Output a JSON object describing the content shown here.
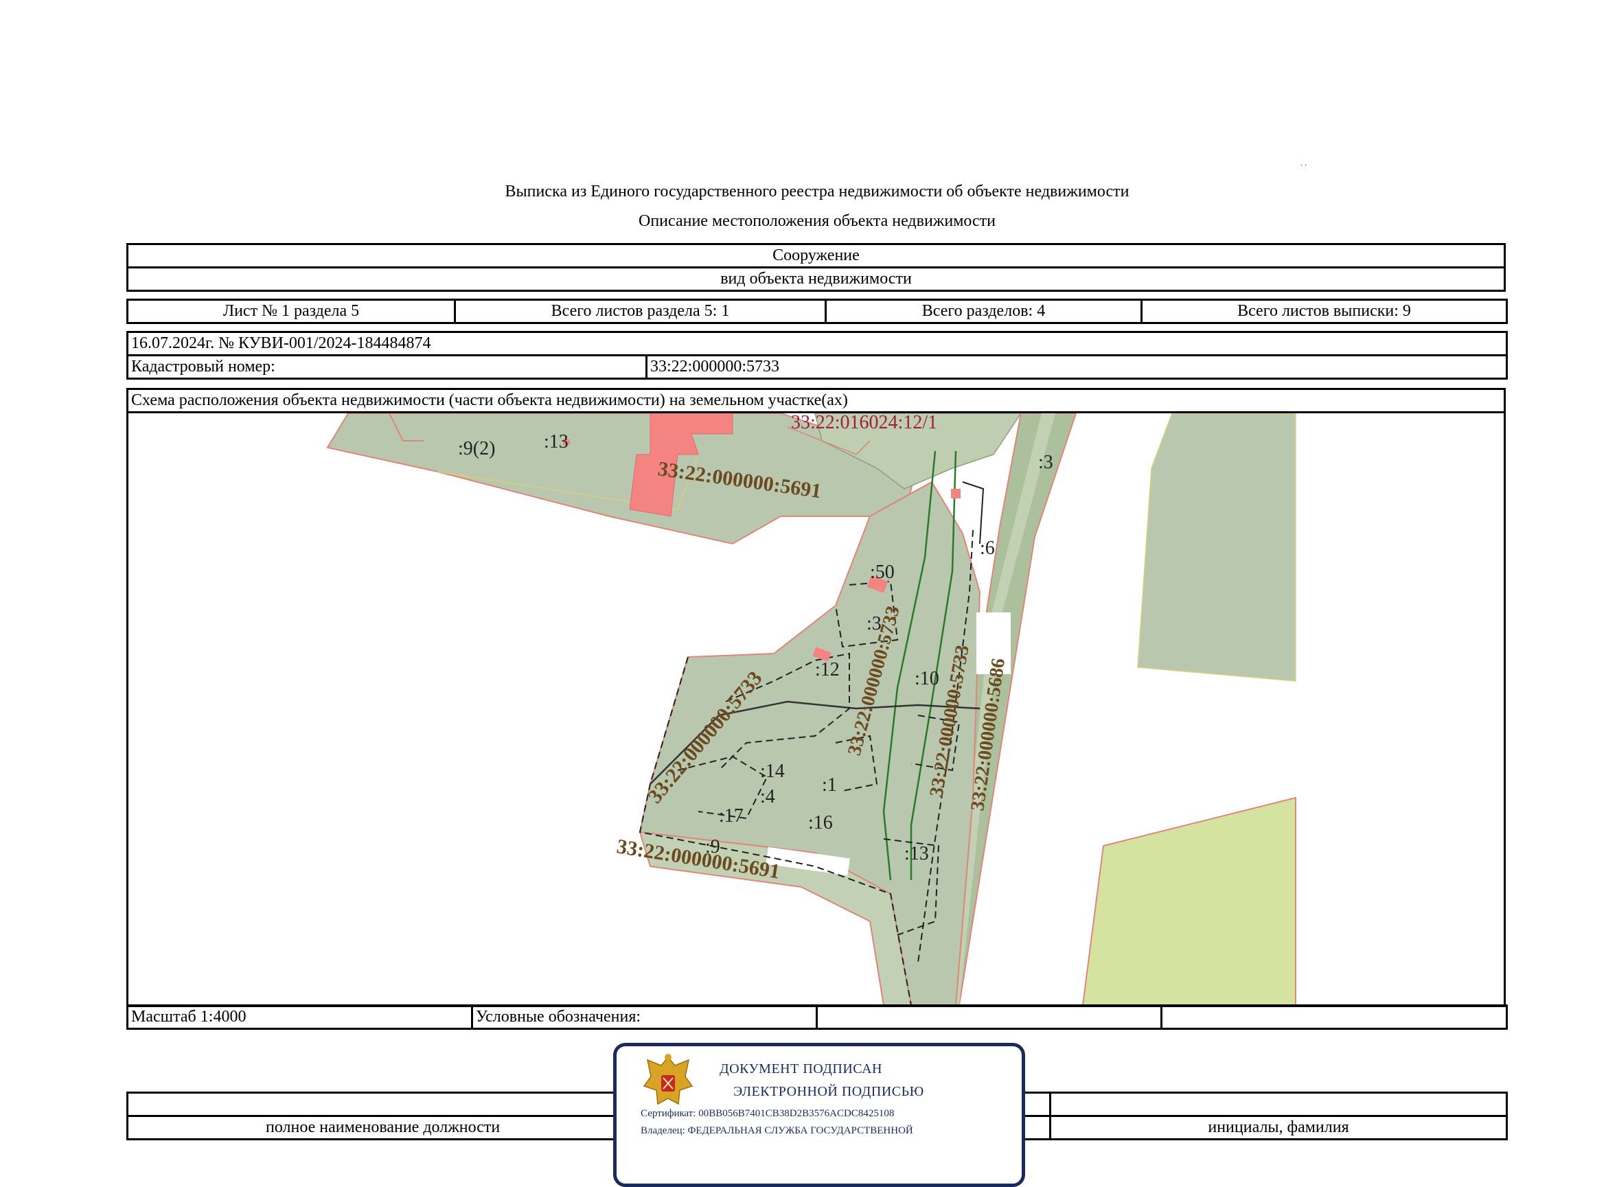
{
  "header": {
    "marks": "· ·",
    "title": "Выписка из Единого государственного реестра недвижимости об объекте недвижимости",
    "subtitle": "Описание местоположения объекта недвижимости"
  },
  "object": {
    "type": "Сооружение",
    "type_caption": "вид объекта недвижимости"
  },
  "sheets": {
    "sheet_no": "Лист № 1 раздела 5",
    "section_sheets": "Всего листов раздела 5: 1",
    "sections_total": "Всего разделов: 4",
    "extract_sheets": "Всего листов выписки: 9"
  },
  "record": {
    "date_number": "16.07.2024г. № КУВИ-001/2024-184484874",
    "cadastral_label": "Кадастровый номер:",
    "cadastral_value": "33:22:000000:5733"
  },
  "scheme": {
    "title": "Схема расположения объекта недвижимости (части объекта недвижимости) на земельном участке(ах)"
  },
  "map": {
    "labels": {
      "top_quarter": "33:22:016024:12/1",
      "road_north": "33:22:000000:5691",
      "road_south": "33:22:000000:5691",
      "obj_a": "33:22:000000:5733",
      "obj_b": "33:22:000000:5733",
      "obj_c": "33:22:000000:5733",
      "obj_d": "33:22:000000:5733",
      "road_east": "33:22:000000:5686",
      "p_9_2": ":9(2)",
      "p_13a": ":13",
      "p_3a": ":3",
      "p_6": ":6",
      "p_50": ":50",
      "p_3b": ":3",
      "p_12": ":12",
      "p_10": ":10",
      "p_14": ":14",
      "p_1": ":1",
      "p_4": ":4",
      "p_17": ":17",
      "p_16": ":16",
      "p_9": ":9",
      "p_13b": ":13"
    }
  },
  "footer": {
    "scale": "Масштаб 1:4000",
    "legend": "Условные обозначения:"
  },
  "signature": {
    "position": "полное наименование должности",
    "initials": "инициалы, фамилия"
  },
  "stamp": {
    "line1": "ДОКУМЕНТ ПОДПИСАН",
    "line2": "ЭЛЕКТРОННОЙ ПОДПИСЬЮ",
    "certificate": "Сертификат: 00BB056B7401CB38D2B3576ACDC8425108",
    "owner": "Владелец: ФЕДЕРАЛЬНАЯ СЛУЖБА ГОСУДАРСТВЕННОЙ"
  },
  "colors": {
    "parcel": "#b9c7ae",
    "field": "#d4e4a0",
    "building": "#f48482",
    "boundary": "#e0857a",
    "cadastral_text": "#6b4a1f",
    "quarter_text": "#a0203a",
    "stamp": "#1a2a5c"
  }
}
